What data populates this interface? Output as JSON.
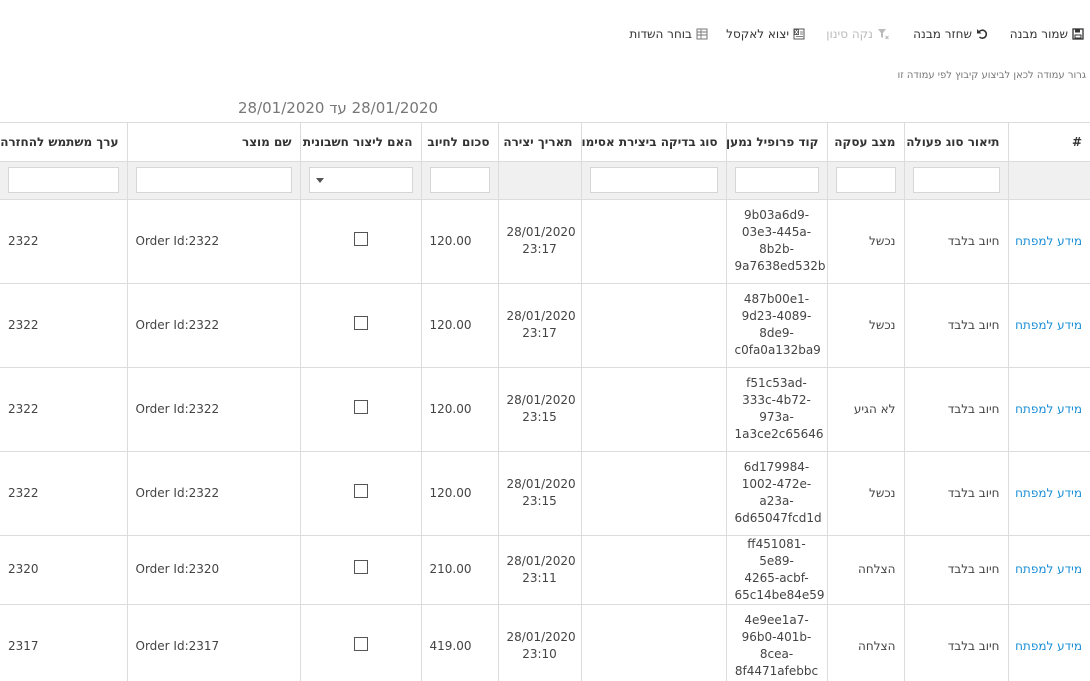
{
  "toolbar": {
    "save_template": "שמור מבנה",
    "restore_template": "שחזר מבנה",
    "clear_filter": "נקה סינון",
    "export_excel": "יצוא לאקסל",
    "field_chooser": "בוחר השדות"
  },
  "group_hint": "גרור עמודה לכאן לביצוע קיבוץ לפי עמודה זו",
  "date_range": "28/01/2020 עד 28/01/2020",
  "columns": {
    "hash": "#",
    "action_type": "תיאור סוג פעולה",
    "deal_state": "מצב עסקה",
    "payee_profile": "קוד פרופיל נמען",
    "token_check_type": "סוג בדיקה ביצירת אסימון",
    "created_date": "תאריך יצירה",
    "charge_amount": "סכום לחיוב",
    "create_invoice": "האם ליצור חשבונית",
    "product_name": "שם מוצר",
    "return_user_value": "ערך משתמש להחזרה"
  },
  "rows": [
    {
      "link": "מידע למפתח",
      "action_type": "חיוב בלבד",
      "deal_state": "נכשל",
      "profile": [
        "9b03a6d9-",
        "03e3-445a-",
        "8b2b-",
        "9a7638ed532b"
      ],
      "token_type": "",
      "date": "28/01/2020",
      "time": "23:17",
      "amount": "120.00",
      "invoice": false,
      "product": "Order Id:2322",
      "return_value": "2322"
    },
    {
      "link": "מידע למפתח",
      "action_type": "חיוב בלבד",
      "deal_state": "נכשל",
      "profile": [
        "487b00e1-",
        "9d23-4089-",
        "8de9-",
        "c0fa0a132ba9"
      ],
      "token_type": "",
      "date": "28/01/2020",
      "time": "23:17",
      "amount": "120.00",
      "invoice": false,
      "product": "Order Id:2322",
      "return_value": "2322"
    },
    {
      "link": "מידע למפתח",
      "action_type": "חיוב בלבד",
      "deal_state": "לא הגיע",
      "profile": [
        "f51c53ad-",
        "333c-4b72-",
        "973a-",
        "1a3ce2c65646"
      ],
      "token_type": "",
      "date": "28/01/2020",
      "time": "23:15",
      "amount": "120.00",
      "invoice": false,
      "product": "Order Id:2322",
      "return_value": "2322"
    },
    {
      "link": "מידע למפתח",
      "action_type": "חיוב בלבד",
      "deal_state": "נכשל",
      "profile": [
        "6d179984-",
        "1002-472e-",
        "a23a-",
        "6d65047fcd1d"
      ],
      "token_type": "",
      "date": "28/01/2020",
      "time": "23:15",
      "amount": "120.00",
      "invoice": false,
      "product": "Order Id:2322",
      "return_value": "2322"
    },
    {
      "link": "מידע למפתח",
      "action_type": "חיוב בלבד",
      "deal_state": "הצלחה",
      "profile": [
        "ff451081-5e89-",
        "4265-acbf-",
        "65c14be84e59"
      ],
      "token_type": "",
      "date": "28/01/2020",
      "time": "23:11",
      "amount": "210.00",
      "invoice": false,
      "product": "Order Id:2320",
      "return_value": "2320"
    },
    {
      "link": "מידע למפתח",
      "action_type": "חיוב בלבד",
      "deal_state": "הצלחה",
      "profile": [
        "4e9ee1a7-",
        "96b0-401b-",
        "8cea-",
        "8f4471afebbc"
      ],
      "token_type": "",
      "date": "28/01/2020",
      "time": "23:10",
      "amount": "419.00",
      "invoice": false,
      "product": "Order Id:2317",
      "return_value": "2317"
    }
  ]
}
